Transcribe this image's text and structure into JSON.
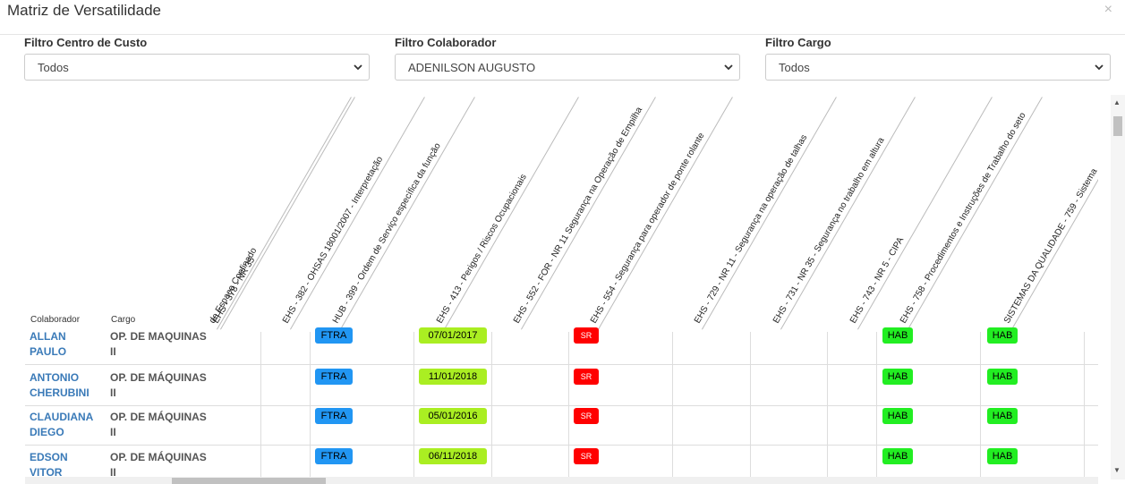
{
  "modal": {
    "title": "Matriz de Versatilidade",
    "close": "×"
  },
  "filters": [
    {
      "label": "Filtro Centro de Custo",
      "value": "Todos"
    },
    {
      "label": "Filtro Colaborador",
      "value": "ADENILSON AUGUSTO"
    },
    {
      "label": "Filtro Cargo",
      "value": "Todos"
    }
  ],
  "matrix": {
    "headers": [
      "de Espaço Confinado",
      "EHS - 378 - NR 35",
      "EHS - 382 - OHSAS 18001/2007 - Interpretação",
      "HUB - 399 - Ordem de Serviço específica da função",
      "EHS - 413 - Perigos / Riscos Ocupacionais",
      "EHS - 552 - FOR - NR 11 Segurança na Operação de Empilha",
      "EHS - 554 - Segurança para operador de ponte rolante",
      "EHS - 729 - NR 11 - Segurança na operação de talhas",
      "EHS - 731 - NR 35 - Segurança no trabalho em altura",
      "EHS - 743 - NR 5 - CIPA",
      "EHS - 758 - Procedimentos e Instruções de Trabalho do seto",
      "SISTEMAS DA QUALIDADE - 759 - Sistema"
    ],
    "col_colaborador": "Colaborador",
    "col_cargo": "Cargo",
    "rows": [
      {
        "name": "ALLAN PAULO",
        "cargo": "OP. DE MAQUINAS II",
        "ftra": "FTRA",
        "date": "07/01/2017",
        "sr": "SR",
        "hab1": "HAB",
        "hab2": "HAB"
      },
      {
        "name": "ANTONIO CHERUBINI",
        "cargo": "OP. DE MÁQUINAS II",
        "ftra": "FTRA",
        "date": "11/01/2018",
        "sr": "SR",
        "hab1": "HAB",
        "hab2": "HAB"
      },
      {
        "name": "CLAUDIANA DIEGO",
        "cargo": "OP. DE MÁQUINAS II",
        "ftra": "FTRA",
        "date": "05/01/2016",
        "sr": "SR",
        "hab1": "HAB",
        "hab2": "HAB"
      },
      {
        "name": "EDSON VITOR",
        "cargo": "OP. DE MÁQUINAS II",
        "ftra": "FTRA",
        "date": "06/11/2018",
        "sr": "SR",
        "hab1": "HAB",
        "hab2": "HAB"
      }
    ]
  }
}
